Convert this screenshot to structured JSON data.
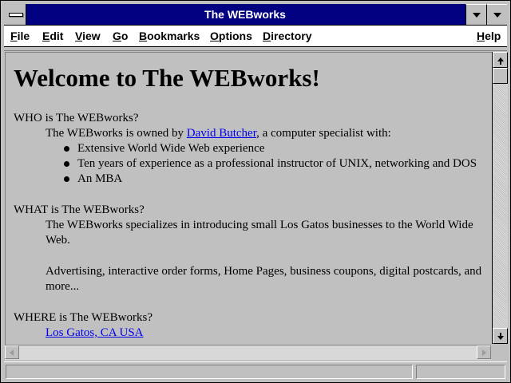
{
  "window": {
    "title": "The WEBworks"
  },
  "menu": {
    "items": [
      "File",
      "Edit",
      "View",
      "Go",
      "Bookmarks",
      "Options",
      "Directory"
    ],
    "help": "Help"
  },
  "page": {
    "heading": "Welcome to The WEBworks!",
    "who": {
      "question": "WHO is The WEBworks?",
      "intro_before": "The WEBworks is owned by ",
      "link": "David Butcher",
      "intro_after": ", a computer specialist with:",
      "bullets": [
        "Extensive World Wide Web experience",
        "Ten years of experience as a professional instructor of UNIX, networking and DOS",
        "An MBA"
      ]
    },
    "what": {
      "question": "WHAT is The WEBworks?",
      "p1_line1": "The WEBworks specializes in introducing small Los Gatos businesses to the World Wide",
      "p1_line2": "Web.",
      "p2_line1": "Advertising, interactive order forms, Home Pages, business coupons, digital postcards, and",
      "p2_line2": "more..."
    },
    "where": {
      "question": "WHERE is The WEBworks?",
      "link": "Los Gatos, CA USA"
    }
  },
  "status": {
    "message": ""
  },
  "icons": {
    "system_menu": "system-menu-icon",
    "minimize": "minimize-icon",
    "maximize": "maximize-icon",
    "scroll_up": "arrow-up-icon",
    "scroll_down": "arrow-down-icon",
    "scroll_left": "arrow-left-icon",
    "scroll_right": "arrow-right-icon"
  },
  "colors": {
    "title_bar": "#000080",
    "link": "#0000ee",
    "background": "#c0c0c0"
  }
}
